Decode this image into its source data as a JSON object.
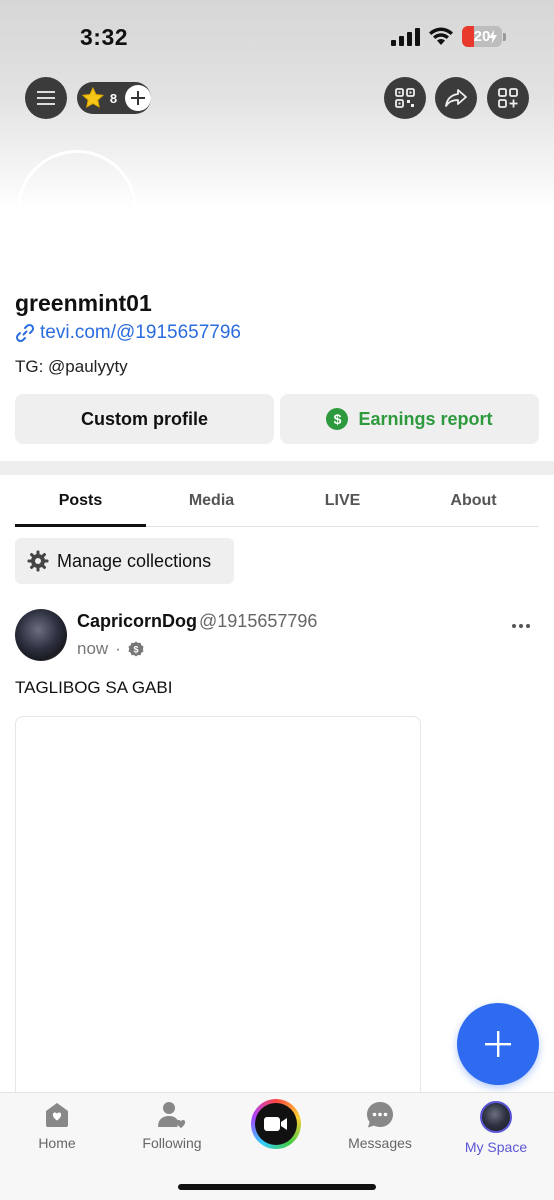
{
  "status_bar": {
    "time": "3:32",
    "battery": "20"
  },
  "header": {
    "coin_count": "8"
  },
  "profile": {
    "username": "greenmint01",
    "link": "tevi.com/@1915657796",
    "bio": "TG: @paulyyty",
    "custom_profile_label": "Custom profile",
    "earnings_report_label": "Earnings report"
  },
  "tabs": [
    {
      "label": "Posts",
      "active": true
    },
    {
      "label": "Media"
    },
    {
      "label": "LIVE"
    },
    {
      "label": "About"
    }
  ],
  "collections": {
    "label": "Manage collections"
  },
  "post": {
    "author_name": "CapricornDog",
    "author_handle": "@1915657796",
    "time": "now",
    "text": "TAGLIBOG SA GABI"
  },
  "bottom_nav": [
    {
      "label": "Home",
      "icon": "home-icon"
    },
    {
      "label": "Following",
      "icon": "following-icon"
    },
    {
      "label": "",
      "icon": "video-camera-icon"
    },
    {
      "label": "Messages",
      "icon": "messages-icon"
    },
    {
      "label": "My Space",
      "icon": "avatar",
      "active": true
    }
  ],
  "colors": {
    "link": "#2b6cde",
    "earnings": "#2e9a3e",
    "fab": "#2f6bf0",
    "active_nav": "#5b57d6"
  }
}
